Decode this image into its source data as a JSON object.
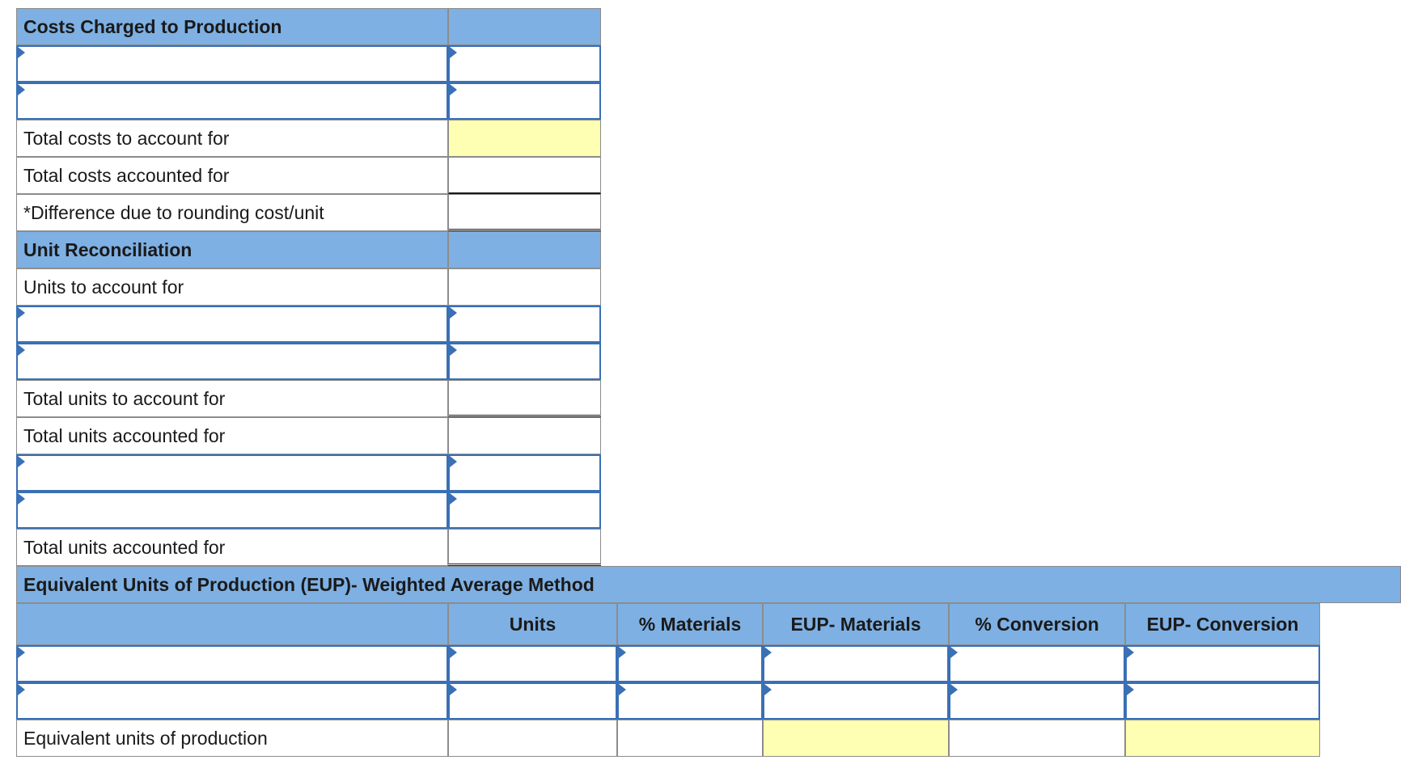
{
  "costs_section": {
    "title": "Costs Charged to Production",
    "total_costs_to_account": "Total costs to account for",
    "total_costs_accounted": "Total costs accounted for",
    "difference_rounding": "*Difference due to rounding cost/unit"
  },
  "unit_section": {
    "title": "Unit Reconciliation",
    "units_to_account": "Units to account for",
    "total_units_to_account": "Total units to account for",
    "total_units_accounted_1": "Total units accounted for",
    "total_units_accounted_2": "Total units accounted for"
  },
  "eup_section": {
    "title": "Equivalent Units of Production (EUP)- Weighted Average Method",
    "columns": [
      "Units",
      "% Materials",
      "EUP- Materials",
      "% Conversion",
      "EUP- Conversion"
    ],
    "total_label": "Equivalent units of production"
  },
  "colors": {
    "header_blue": "#7eb0e3",
    "input_border": "#3a70b5",
    "highlight_yellow": "#ffffb3"
  }
}
